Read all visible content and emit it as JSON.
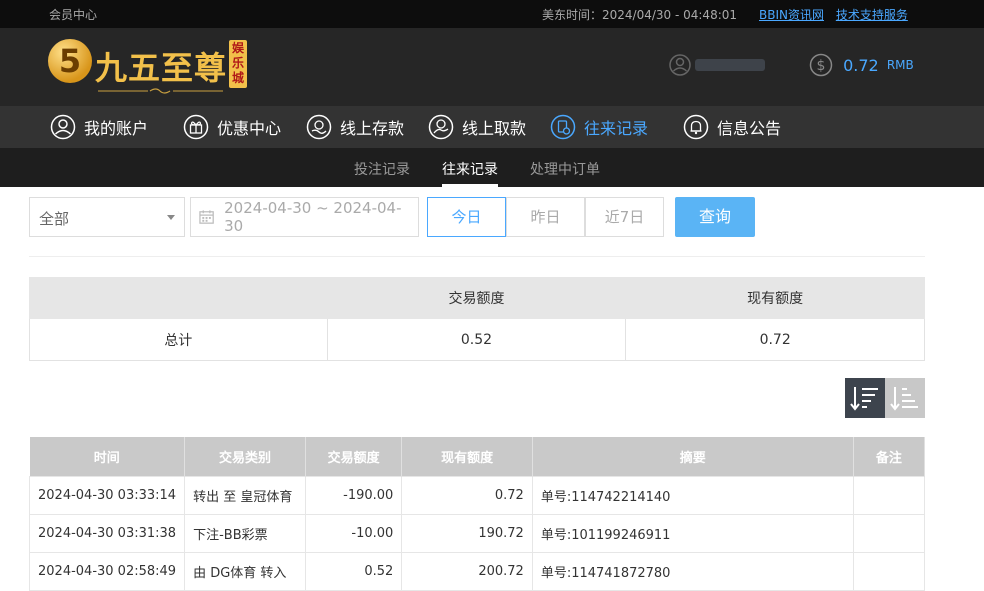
{
  "topbar": {
    "member_center": "会员中心",
    "time": "美东时间：2024/04/30 - 04:48:01",
    "links": [
      "BBIN资讯网",
      "技术支持服务"
    ]
  },
  "header": {
    "logo_text": "九五至尊",
    "logo_badge": "娱乐城",
    "balance_value": "0.72",
    "balance_currency": "RMB"
  },
  "nav": {
    "items": [
      {
        "label": "我的账户",
        "icon": "user-icon"
      },
      {
        "label": "优惠中心",
        "icon": "gift-icon"
      },
      {
        "label": "线上存款",
        "icon": "deposit-icon"
      },
      {
        "label": "线上取款",
        "icon": "withdraw-icon"
      },
      {
        "label": "往来记录",
        "icon": "records-icon",
        "active": true
      },
      {
        "label": "信息公告",
        "icon": "bell-icon"
      }
    ]
  },
  "subnav": {
    "items": [
      "投注记录",
      "往来记录",
      "处理中订单"
    ],
    "active_index": 1
  },
  "filters": {
    "type_select": "全部",
    "date_range": "2024-04-30 ~ 2024-04-30",
    "quick_buttons": [
      "今日",
      "昨日",
      "近7日"
    ],
    "active_quick": 0,
    "query_label": "查询"
  },
  "summary": {
    "headers": [
      "",
      "交易额度",
      "现有额度"
    ],
    "row": [
      "总计",
      "0.52",
      "0.72"
    ]
  },
  "records": {
    "headers": [
      "时间",
      "交易类别",
      "交易额度",
      "现有额度",
      "摘要",
      "备注"
    ],
    "rows": [
      [
        "2024-04-30 03:33:14",
        "转出 至 皇冠体育",
        "-190.00",
        "0.72",
        "单号:114742214140",
        ""
      ],
      [
        "2024-04-30 03:31:38",
        "下注-BB彩票",
        "-10.00",
        "190.72",
        "单号:101199246911",
        ""
      ],
      [
        "2024-04-30 02:58:49",
        "由 DG体育 转入",
        "0.52",
        "200.72",
        "单号:114741872780",
        ""
      ]
    ]
  },
  "colors": {
    "accent": "#4aa8ff",
    "gold": "#f2c04a",
    "header_bg": "#262626"
  }
}
